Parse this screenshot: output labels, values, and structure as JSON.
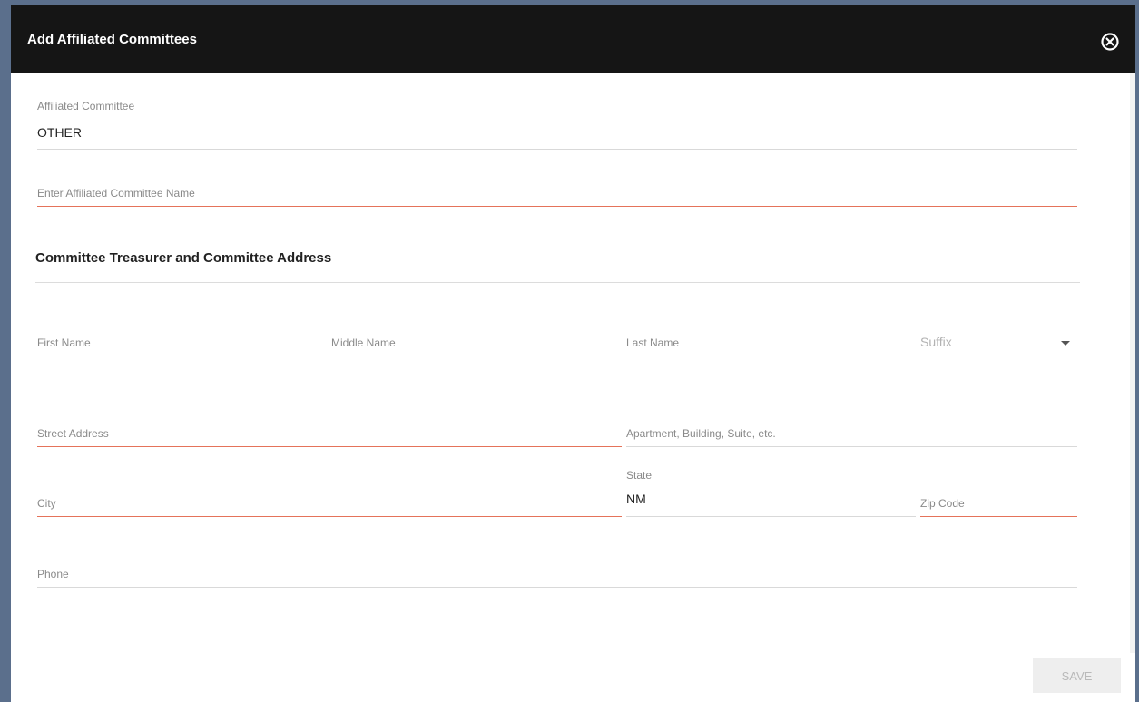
{
  "dialog": {
    "title": "Add Affiliated Committees",
    "close_icon": "close-circle-icon"
  },
  "affiliated_committee": {
    "label": "Affiliated Committee",
    "value": "OTHER"
  },
  "committee_name": {
    "placeholder": "Enter Affiliated Committee Name"
  },
  "section": {
    "title": "Committee Treasurer and Committee Address"
  },
  "name_fields": {
    "first_name": "First Name",
    "middle_name": "Middle Name",
    "last_name": "Last Name",
    "suffix": "Suffix",
    "suffix_icon": "chevron-down-icon"
  },
  "address_fields": {
    "street": "Street Address",
    "apartment": "Apartment, Building, Suite, etc.",
    "city": "City",
    "state_label": "State",
    "state_value": "NM",
    "zip": "Zip Code",
    "phone": "Phone"
  },
  "footer": {
    "save_label": "SAVE"
  },
  "colors": {
    "header_bg": "#151515",
    "required_underline": "#e5735a",
    "backdrop": "#5b6f8c"
  }
}
